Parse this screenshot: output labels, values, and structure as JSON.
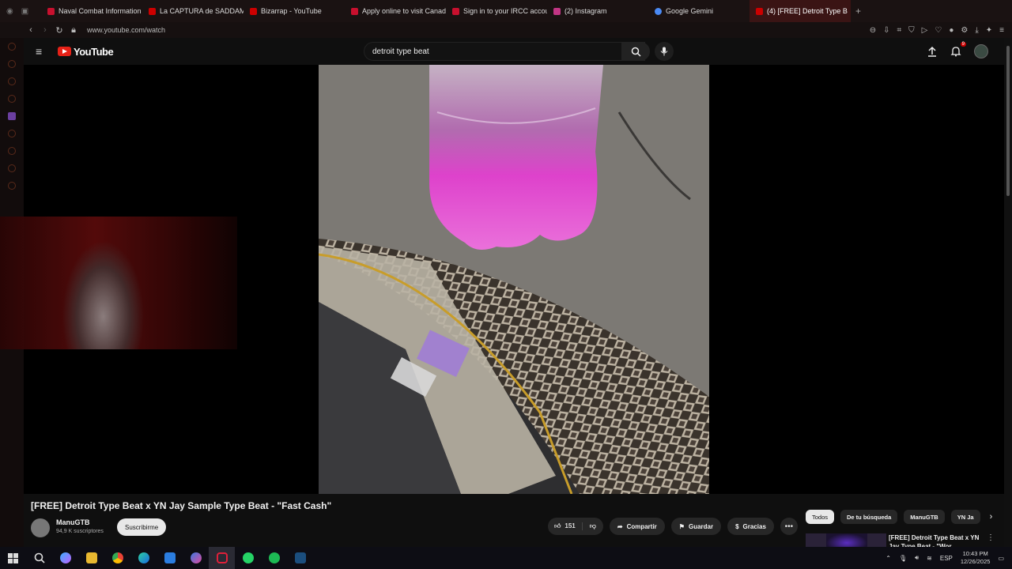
{
  "browser": {
    "tabs": [
      {
        "label": "Naval Combat Information C",
        "color": "#c8102e"
      },
      {
        "label": "La CAPTURA de SADDAM",
        "color": "#cc0000"
      },
      {
        "label": "Bizarrap - YouTube",
        "color": "#cc0000"
      },
      {
        "label": "Apply online to visit Canad",
        "color": "#c8102e"
      },
      {
        "label": "Sign in to your IRCC accour",
        "color": "#c8102e"
      },
      {
        "label": "(2) Instagram",
        "color": "#c13584"
      },
      {
        "label": "Google Gemini",
        "color": "#4a8af4"
      },
      {
        "label": "(4) [FREE] Detroit Type B",
        "color": "#cc0000"
      }
    ],
    "url": "www.youtube.com/watch"
  },
  "youtube": {
    "logo_text": "YouTube",
    "search_value": "detroit type beat",
    "notification_count": "9"
  },
  "video": {
    "title": "[FREE] Detroit Type Beat x YN Jay Sample Type Beat - \"Fast Cash\"",
    "channel_name": "ManuGTB",
    "subscribers": "94,9 K suscriptores",
    "subscribe_label": "Suscribirme",
    "likes": "151",
    "share_label": "Compartir",
    "save_label": "Guardar",
    "thanks_label": "Gracias"
  },
  "recommendations": {
    "chips": [
      "Todos",
      "De tu búsqueda",
      "ManuGTB",
      "YN Ja"
    ],
    "first_title": "[FREE] Detroit Type Beat x YN Jay Type Beat - \"Wor"
  },
  "taskbar": {
    "language": "ESP",
    "time": "10:43 PM",
    "date": "12/26/2025"
  }
}
